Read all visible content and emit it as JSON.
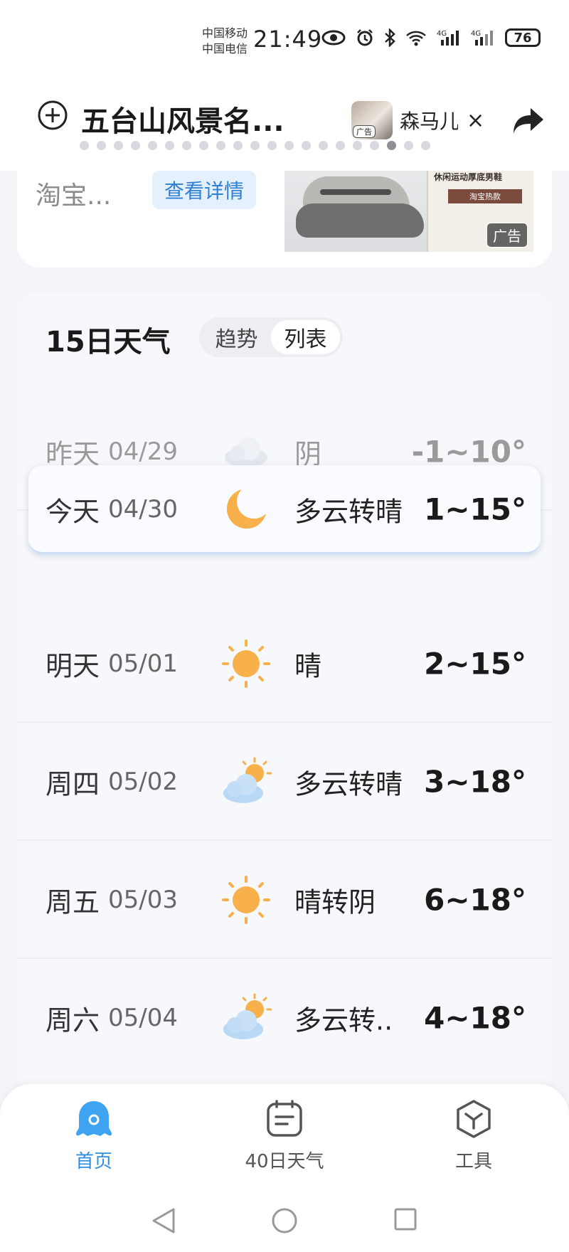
{
  "status_bar": {
    "carrier_1": "中国移动",
    "carrier_2": "中国电信",
    "time": "21:49",
    "battery": "76",
    "icons": [
      "eye-icon",
      "alarm-icon",
      "bluetooth-icon",
      "wifi-icon",
      "signal-4g-icon",
      "signal-4g-icon"
    ]
  },
  "header": {
    "add_icon": "plus-circle-icon",
    "location_title": "五台山风景名...",
    "ad_chip_tag": "广告",
    "ad_chip_text": "森马儿",
    "close_label": "×",
    "share_icon": "share-arrow-icon",
    "page_count": 21,
    "active_page_index": 18
  },
  "ad_card": {
    "text": "淘宝...",
    "detail_button": "查看详情",
    "image_caption": "休闲运动厚底男鞋",
    "image_button": "淘宝热款",
    "ad_label": "广告"
  },
  "forecast": {
    "title": "15日天气",
    "toggle": {
      "options": [
        "趋势",
        "列表"
      ],
      "selected": "列表"
    },
    "days": [
      {
        "name": "昨天",
        "date": "04/29",
        "icon": "overcast-cloud-icon",
        "condition": "阴",
        "temp": "-1~10°",
        "state": "past"
      },
      {
        "name": "今天",
        "date": "04/30",
        "icon": "crescent-moon-icon",
        "condition": "多云转晴",
        "temp": "1~15°",
        "state": "today"
      },
      {
        "name": "明天",
        "date": "05/01",
        "icon": "sun-icon",
        "condition": "晴",
        "temp": "2~15°",
        "state": "future"
      },
      {
        "name": "周四",
        "date": "05/02",
        "icon": "partly-cloudy-icon",
        "condition": "多云转晴",
        "temp": "3~18°",
        "state": "future"
      },
      {
        "name": "周五",
        "date": "05/03",
        "icon": "sun-icon",
        "condition": "晴转阴",
        "temp": "6~18°",
        "state": "future"
      },
      {
        "name": "周六",
        "date": "05/04",
        "icon": "partly-cloudy-icon",
        "condition": "多云转..",
        "temp": "4~18°",
        "state": "future"
      }
    ]
  },
  "bottom_nav": {
    "items": [
      {
        "label": "首页",
        "icon": "home-ghost-icon",
        "active": true
      },
      {
        "label": "40日天气",
        "icon": "calendar-icon",
        "active": false
      },
      {
        "label": "工具",
        "icon": "toolbox-cube-icon",
        "active": false
      }
    ]
  },
  "system_nav": {
    "icons": [
      "back-triangle-icon",
      "home-circle-icon",
      "recents-square-icon"
    ]
  },
  "colors": {
    "accent": "#2f8de4",
    "sun": "#f7b04a",
    "cloud": "#b9d8f5",
    "background": "#f3f5f9"
  }
}
